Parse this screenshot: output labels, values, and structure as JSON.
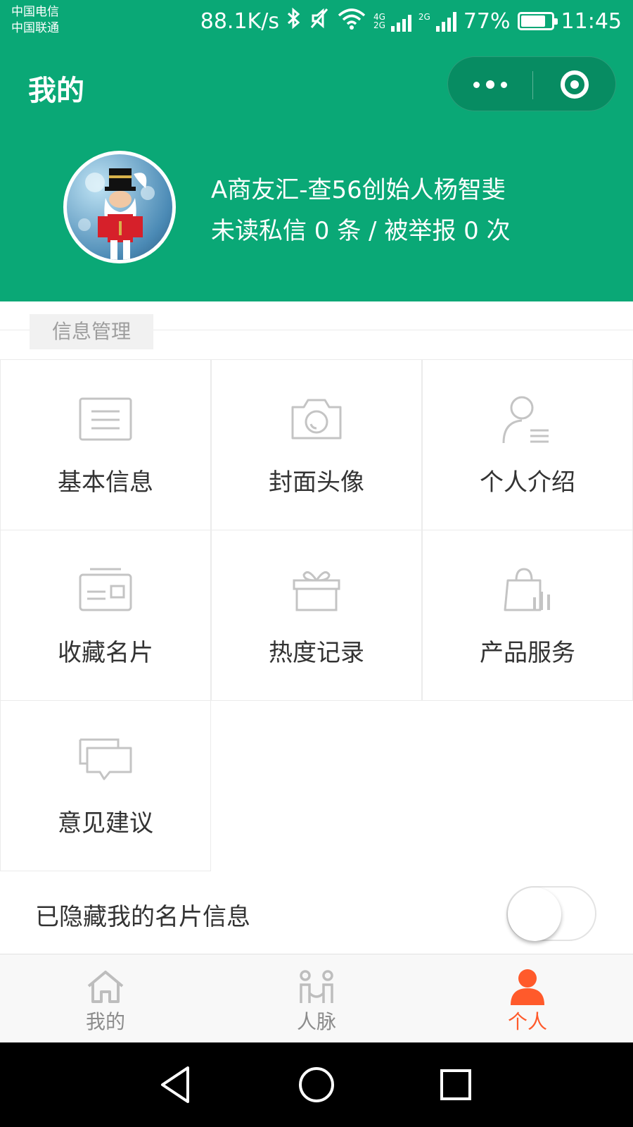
{
  "status_bar": {
    "carrier_1": "中国电信",
    "carrier_2": "中国联通",
    "speed": "88.1K/s",
    "net_1_top": "4G",
    "net_1_bottom": "2G",
    "net_2": "2G",
    "battery_pct": "77%",
    "battery_level": 0.77,
    "time": "11:45"
  },
  "nav": {
    "title": "我的"
  },
  "profile": {
    "name": "A商友汇-查56创始人杨智斐",
    "stats": "未读私信 0 条 / 被举报 0 次"
  },
  "section": {
    "title": "信息管理"
  },
  "grid": {
    "items": [
      {
        "label": "基本信息",
        "icon": "document-icon"
      },
      {
        "label": "封面头像",
        "icon": "camera-icon"
      },
      {
        "label": "个人介绍",
        "icon": "person-list-icon"
      },
      {
        "label": "收藏名片",
        "icon": "card-icon"
      },
      {
        "label": "热度记录",
        "icon": "gift-icon"
      },
      {
        "label": "产品服务",
        "icon": "shopping-bag-icon"
      },
      {
        "label": "意见建议",
        "icon": "chat-icon"
      }
    ]
  },
  "hide_card": {
    "label": "已隐藏我的名片信息",
    "enabled": false
  },
  "tabbar": {
    "tabs": [
      {
        "label": "我的",
        "icon": "home-icon",
        "active": false
      },
      {
        "label": "人脉",
        "icon": "connections-icon",
        "active": false
      },
      {
        "label": "个人",
        "icon": "person-icon",
        "active": true
      }
    ]
  },
  "colors": {
    "brand_green": "#0aa876",
    "active_tab": "#ff5a2b",
    "icon_gray": "#c4c4c4"
  }
}
